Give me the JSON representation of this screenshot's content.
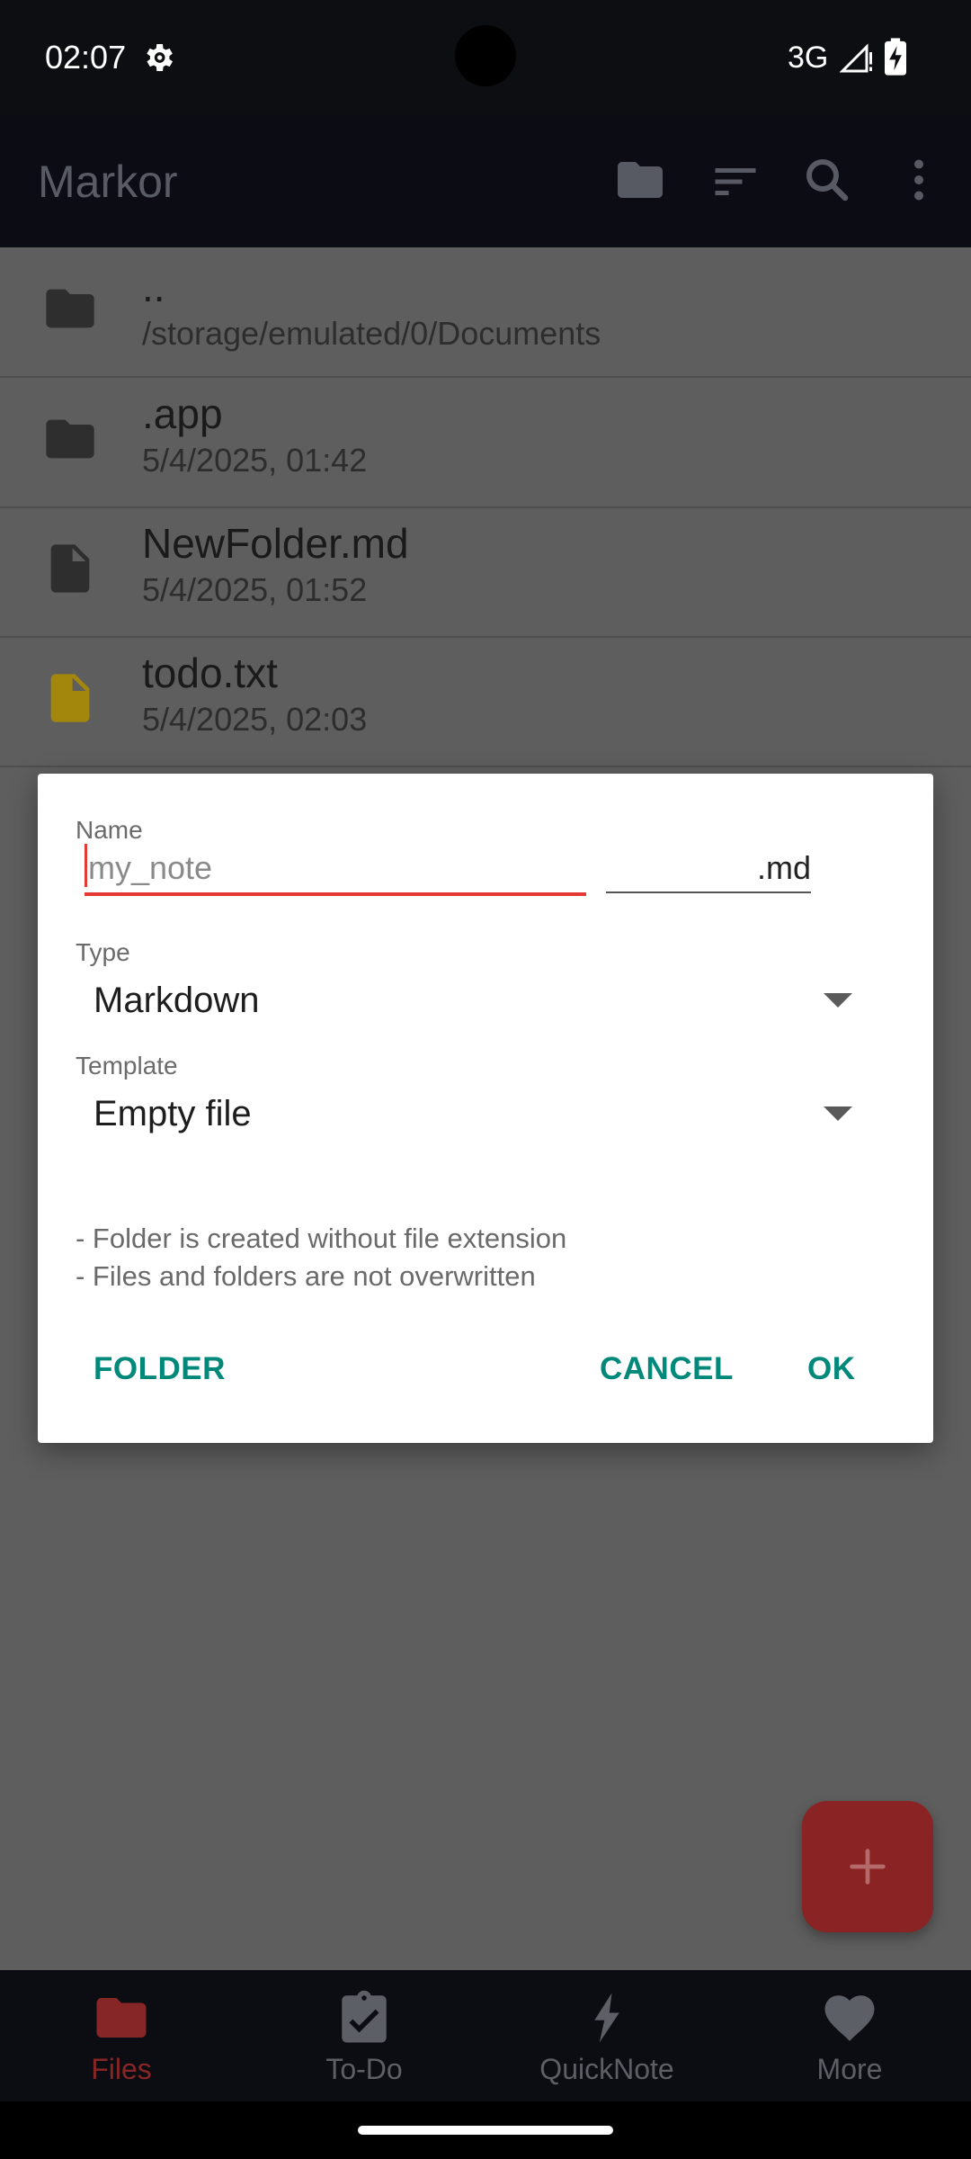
{
  "status_bar": {
    "time": "02:07",
    "network": "3G",
    "icons": [
      "gear-icon",
      "signal-icon",
      "battery-charging-icon"
    ]
  },
  "app_bar": {
    "title": "Markor",
    "actions": [
      "folder-icon",
      "sort-icon",
      "search-icon",
      "more-vert-icon"
    ]
  },
  "files": [
    {
      "name": "..",
      "subtitle": "/storage/emulated/0/Documents",
      "icon": "folder-icon"
    },
    {
      "name": ".app",
      "subtitle": "5/4/2025, 01:42",
      "icon": "folder-icon"
    },
    {
      "name": "NewFolder.md",
      "subtitle": "5/4/2025, 01:52",
      "icon": "file-icon"
    },
    {
      "name": "todo.txt",
      "subtitle": "5/4/2025, 02:03",
      "icon": "todo-file-icon"
    }
  ],
  "dialog": {
    "name_label": "Name",
    "name_placeholder": "my_note",
    "name_value": "",
    "extension_value": ".md",
    "type_label": "Type",
    "type_value": "Markdown",
    "template_label": "Template",
    "template_value": "Empty file",
    "info_lines": [
      "- Folder is created without file extension",
      "- Files and folders are not overwritten"
    ],
    "buttons": {
      "folder": "FOLDER",
      "cancel": "CANCEL",
      "ok": "OK"
    }
  },
  "fab": {
    "icon": "plus-icon"
  },
  "bottom_nav": [
    {
      "label": "Files",
      "icon": "folder-icon",
      "active": true
    },
    {
      "label": "To-Do",
      "icon": "clipboard-check-icon",
      "active": false
    },
    {
      "label": "QuickNote",
      "icon": "lightning-icon",
      "active": false
    },
    {
      "label": "More",
      "icon": "heart-icon",
      "active": false
    }
  ],
  "colors": {
    "accent": "#00887a",
    "error_underline": "#e53935",
    "active_nav": "#872626",
    "todo_icon": "#a3870c"
  }
}
